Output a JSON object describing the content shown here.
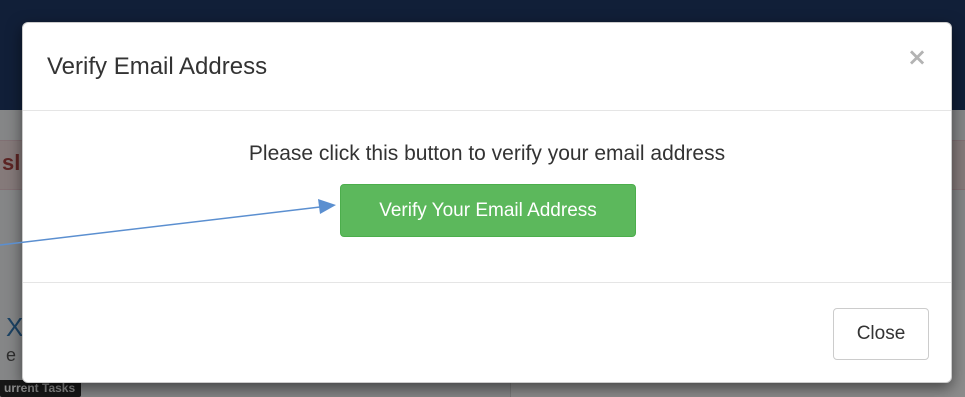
{
  "background": {
    "alert_fragment": "sl",
    "heading_fragment": "X",
    "subtext_fragment": "e",
    "tag_label": "urrent Tasks"
  },
  "modal": {
    "title": "Verify Email Address",
    "close_icon": "×",
    "message": "Please click this button to verify your email address",
    "verify_button_label": "Verify Your Email Address",
    "footer_close_label": "Close"
  },
  "colors": {
    "verify_button": "#5cb85c",
    "annotation_arrow": "#5b8fd0",
    "top_bar": "#1f3a67"
  },
  "icons": {
    "close": "close-icon",
    "annotation": "arrow-icon"
  }
}
